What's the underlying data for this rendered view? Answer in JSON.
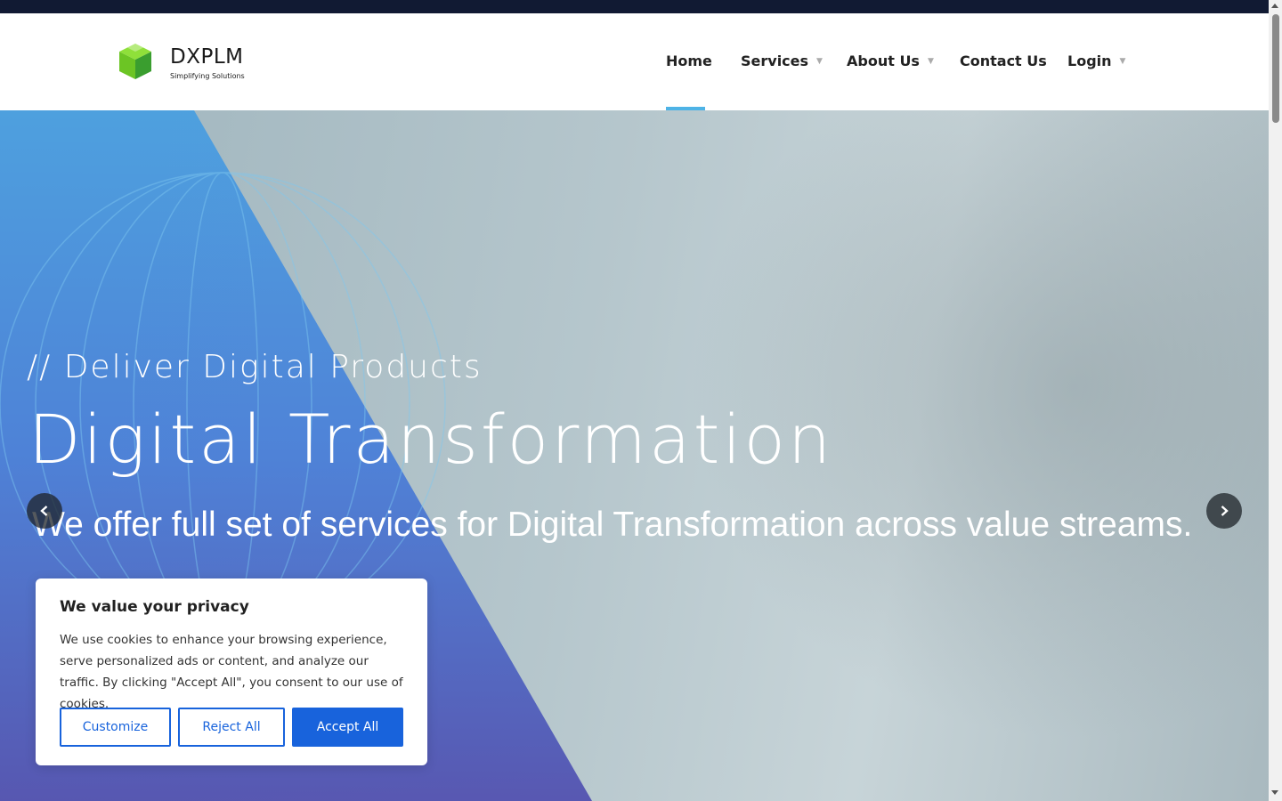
{
  "brand": {
    "name": "DXPLM",
    "tagline": "Simplifying Solutions",
    "colors": {
      "green": "#7ed321",
      "dark_green": "#3a9e2f"
    }
  },
  "nav": {
    "items": [
      {
        "label": "Home",
        "has_dropdown": false,
        "active": true
      },
      {
        "label": "Services",
        "has_dropdown": true
      },
      {
        "label": "About Us",
        "has_dropdown": true
      },
      {
        "label": "Contact Us",
        "has_dropdown": false
      },
      {
        "label": "Login",
        "has_dropdown": true
      }
    ],
    "active_color": "#4eb3e6"
  },
  "hero": {
    "subtitle": "// Deliver Digital Products",
    "title": "Digital Transformation",
    "text": "We offer full set of services for Digital Transformation across value streams.",
    "prev_icon": "chevron-left-icon",
    "next_icon": "chevron-right-icon"
  },
  "cookie": {
    "title": "We value your privacy",
    "body": "We use cookies to enhance your browsing experience, serve personalized ads or content, and analyze our traffic. By clicking \"Accept All\", you consent to our use of cookies.",
    "customize_label": "Customize",
    "reject_label": "Reject All",
    "accept_label": "Accept All",
    "accent": "#1863dc"
  }
}
